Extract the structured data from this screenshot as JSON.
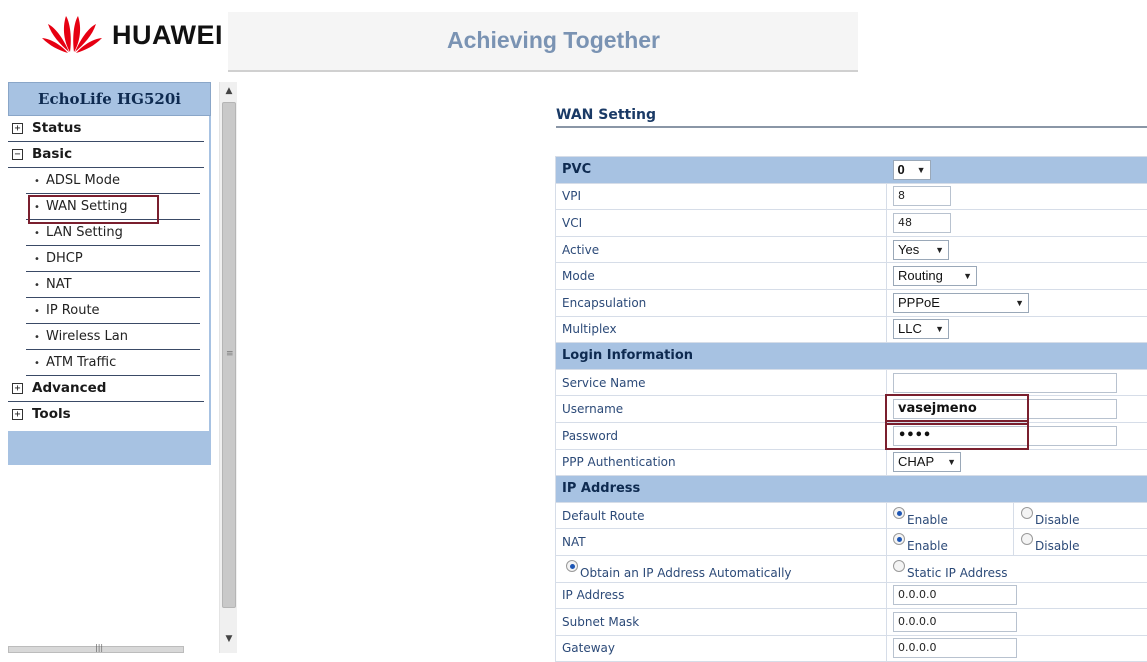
{
  "header": {
    "brand": "HUAWEI",
    "slogan": "Achieving Together",
    "logo_color": "#e60012"
  },
  "nav": {
    "title": "EchoLife HG520i",
    "groups": [
      {
        "label": "Status",
        "expanded": false
      },
      {
        "label": "Basic",
        "expanded": true
      },
      {
        "label": "Advanced",
        "expanded": false
      },
      {
        "label": "Tools",
        "expanded": false
      }
    ],
    "basic_items": [
      "ADSL Mode",
      "WAN Setting",
      "LAN Setting",
      "DHCP",
      "NAT",
      "IP Route",
      "Wireless Lan",
      "ATM Traffic"
    ],
    "selected_item": "WAN Setting",
    "expanded_symbol": "−",
    "collapsed_symbol": "+"
  },
  "page": {
    "title": "WAN Setting"
  },
  "form": {
    "pvc": {
      "label": "PVC",
      "value": "0"
    },
    "vpi": {
      "label": "VPI",
      "value": "8"
    },
    "vci": {
      "label": "VCI",
      "value": "48"
    },
    "active": {
      "label": "Active",
      "value": "Yes"
    },
    "mode": {
      "label": "Mode",
      "value": "Routing"
    },
    "encapsulation": {
      "label": "Encapsulation",
      "value": "PPPoE"
    },
    "multiplex": {
      "label": "Multiplex",
      "value": "LLC"
    },
    "login_section": "Login Information",
    "service_name": {
      "label": "Service Name",
      "value": ""
    },
    "username": {
      "label": "Username",
      "value": "vasejmeno"
    },
    "password": {
      "label": "Password",
      "value": "••••"
    },
    "ppp_auth": {
      "label": "PPP Authentication",
      "value": "CHAP"
    },
    "ip_section": "IP Address",
    "default_route": {
      "label": "Default Route",
      "enable": "Enable",
      "disable": "Disable",
      "selected": "Enable"
    },
    "nat": {
      "label": "NAT",
      "enable": "Enable",
      "disable": "Disable",
      "selected": "Enable"
    },
    "ip_mode": {
      "auto": "Obtain an IP Address Automatically",
      "static": "Static IP Address",
      "selected": "auto"
    },
    "ip_address": {
      "label": "IP Address",
      "value": "0.0.0.0"
    },
    "subnet_mask": {
      "label": "Subnet Mask",
      "value": "0.0.0.0"
    },
    "gateway": {
      "label": "Gateway",
      "value": "0.0.0.0"
    }
  },
  "colors": {
    "nav_header": "#a7c2e2",
    "highlight_border": "#7a1f2e",
    "label_text": "#2c4a78"
  }
}
